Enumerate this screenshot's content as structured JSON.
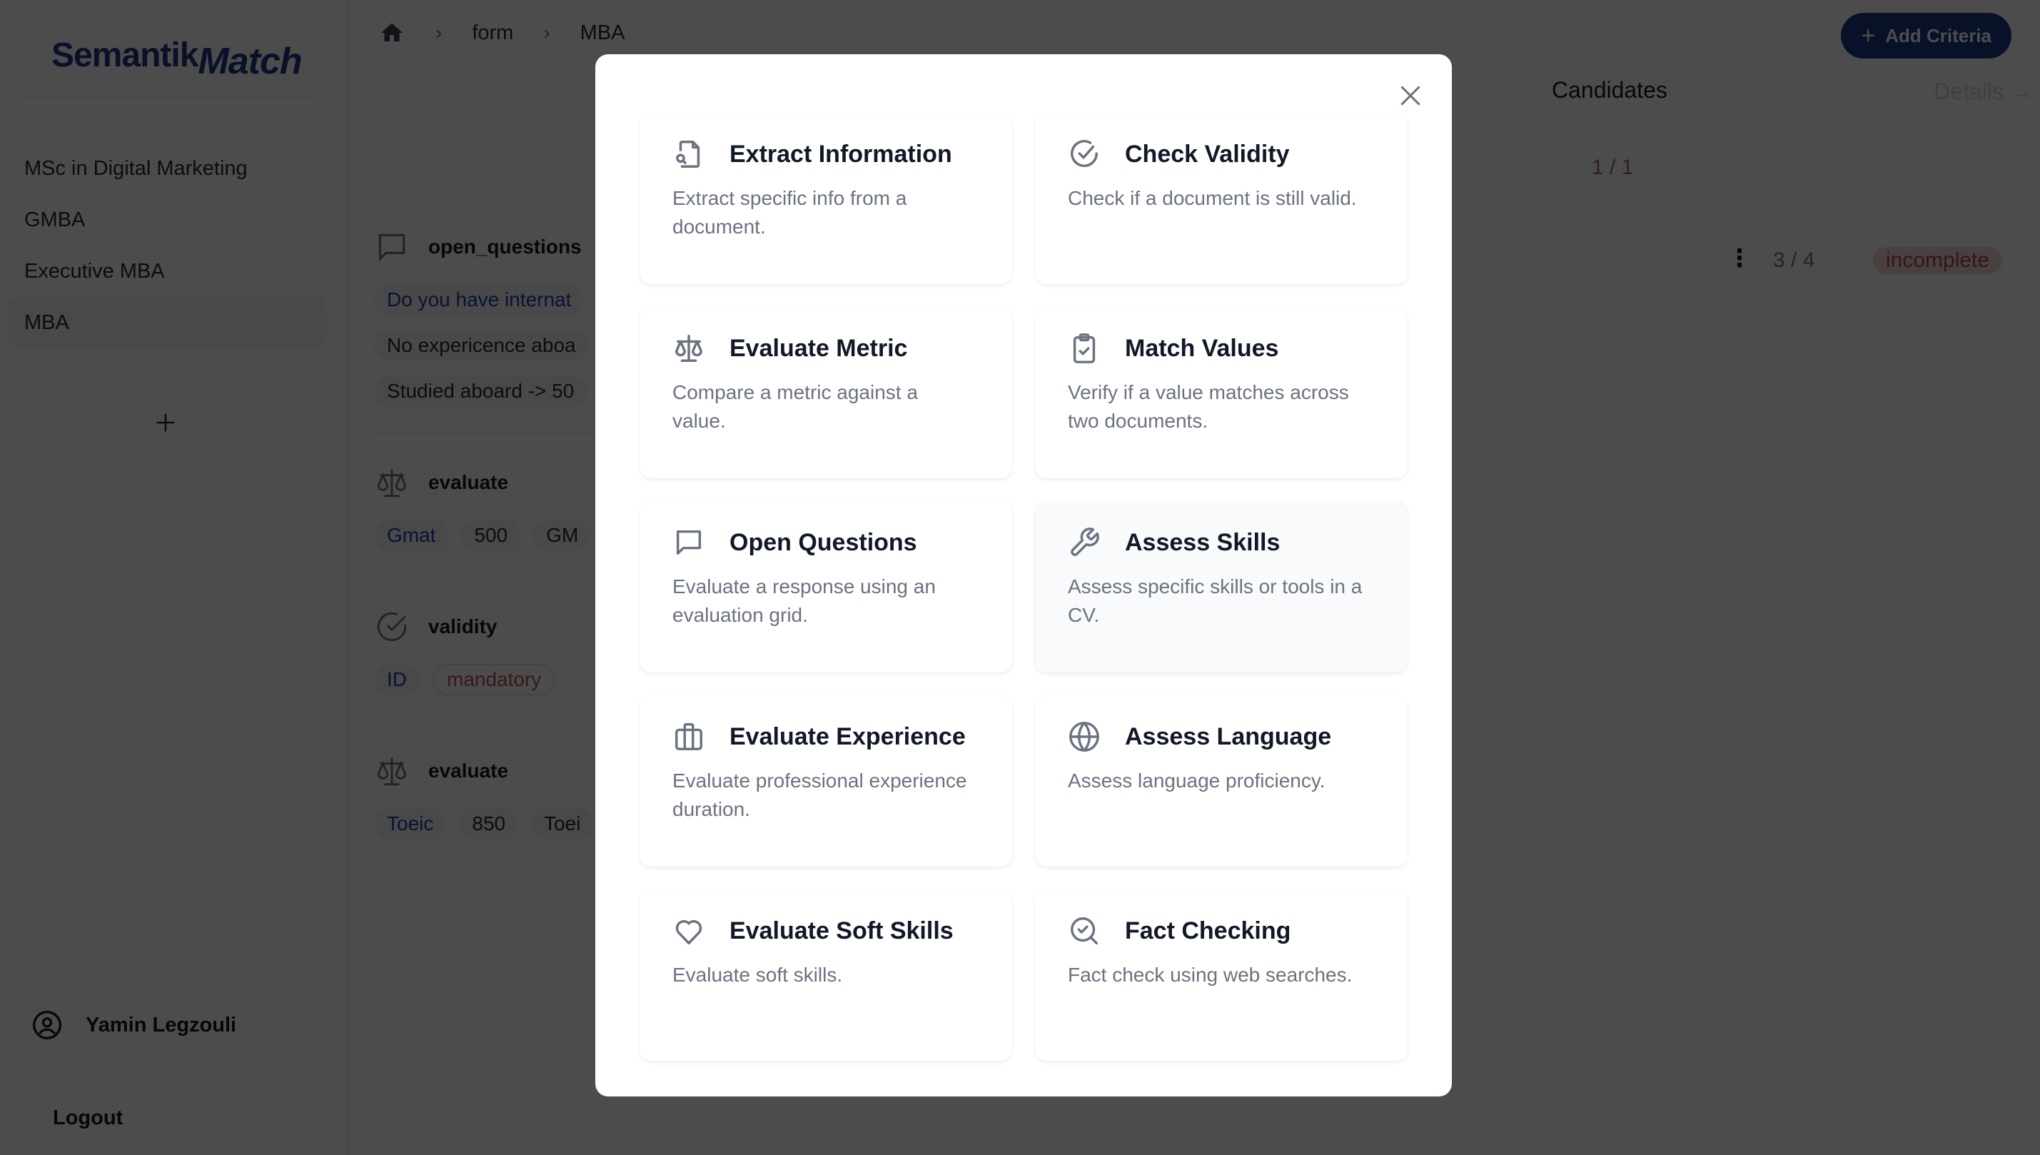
{
  "app": {
    "logo_part1": "Semantik",
    "logo_part2": "Match"
  },
  "sidebar": {
    "programs": [
      {
        "label": "MSc in Digital Marketing",
        "active": false
      },
      {
        "label": "GMBA",
        "active": false
      },
      {
        "label": "Executive MBA",
        "active": false
      },
      {
        "label": "MBA",
        "active": true
      }
    ],
    "add_icon": "plus-icon",
    "user_name": "Yamin Legzouli",
    "logout_label": "Logout"
  },
  "breadcrumb": {
    "home_icon": "home-icon",
    "items": [
      "form",
      "MBA"
    ]
  },
  "header": {
    "add_criteria_label": "Add Criteria",
    "candidates_title": "Candidates",
    "details_label": "Details →"
  },
  "candidates": {
    "summary_count": "1 / 1",
    "row_count": "3 / 4",
    "row_status": "incomplete"
  },
  "criteria": [
    {
      "type": "open_questions",
      "icon": "message-square-icon",
      "chips": [
        {
          "text": "Do you have internat",
          "color": "blue"
        },
        {
          "text": "No expericence aboa",
          "color": "default"
        },
        {
          "text": "Studied aboard -> 50",
          "color": "default"
        }
      ]
    },
    {
      "type": "evaluate",
      "icon": "scale-icon",
      "chips": [
        {
          "text": "Gmat",
          "color": "blue"
        },
        {
          "text": "500",
          "color": "default"
        },
        {
          "text": "GM",
          "color": "default"
        }
      ]
    },
    {
      "type": "validity",
      "icon": "check-circle-icon",
      "chips": [
        {
          "text": "ID",
          "color": "blue"
        },
        {
          "text": "mandatory",
          "color": "red"
        }
      ]
    },
    {
      "type": "evaluate",
      "icon": "scale-icon",
      "chips": [
        {
          "text": "Toeic",
          "color": "blue"
        },
        {
          "text": "850",
          "color": "default"
        },
        {
          "text": "Toei",
          "color": "default"
        }
      ]
    }
  ],
  "modal": {
    "close_icon": "close-icon",
    "options": [
      {
        "title": "Extract Information",
        "description": "Extract specific info from a document.",
        "icon": "file-search-icon"
      },
      {
        "title": "Check Validity",
        "description": "Check if a document is still valid.",
        "icon": "check-circle-icon"
      },
      {
        "title": "Evaluate Metric",
        "description": "Compare a metric against a value.",
        "icon": "scale-icon"
      },
      {
        "title": "Match Values",
        "description": "Verify if a value matches across two documents.",
        "icon": "clipboard-check-icon"
      },
      {
        "title": "Open Questions",
        "description": "Evaluate a response using an evaluation grid.",
        "icon": "message-square-icon"
      },
      {
        "title": "Assess Skills",
        "description": "Assess specific skills or tools in a CV.",
        "icon": "wrench-icon",
        "hover": true
      },
      {
        "title": "Evaluate Experience",
        "description": "Evaluate professional experience duration.",
        "icon": "briefcase-icon"
      },
      {
        "title": "Assess Language",
        "description": "Assess language proficiency.",
        "icon": "globe-icon"
      },
      {
        "title": "Evaluate Soft Skills",
        "description": "Evaluate soft skills.",
        "icon": "heart-icon"
      },
      {
        "title": "Fact Checking",
        "description": "Fact check using web searches.",
        "icon": "search-check-icon"
      }
    ]
  },
  "colors": {
    "brand": "#1e3a8a",
    "status_incomplete_bg": "#f3d6d6",
    "status_incomplete_text": "#b04a4a",
    "chip_blue_text": "#1e40af"
  }
}
